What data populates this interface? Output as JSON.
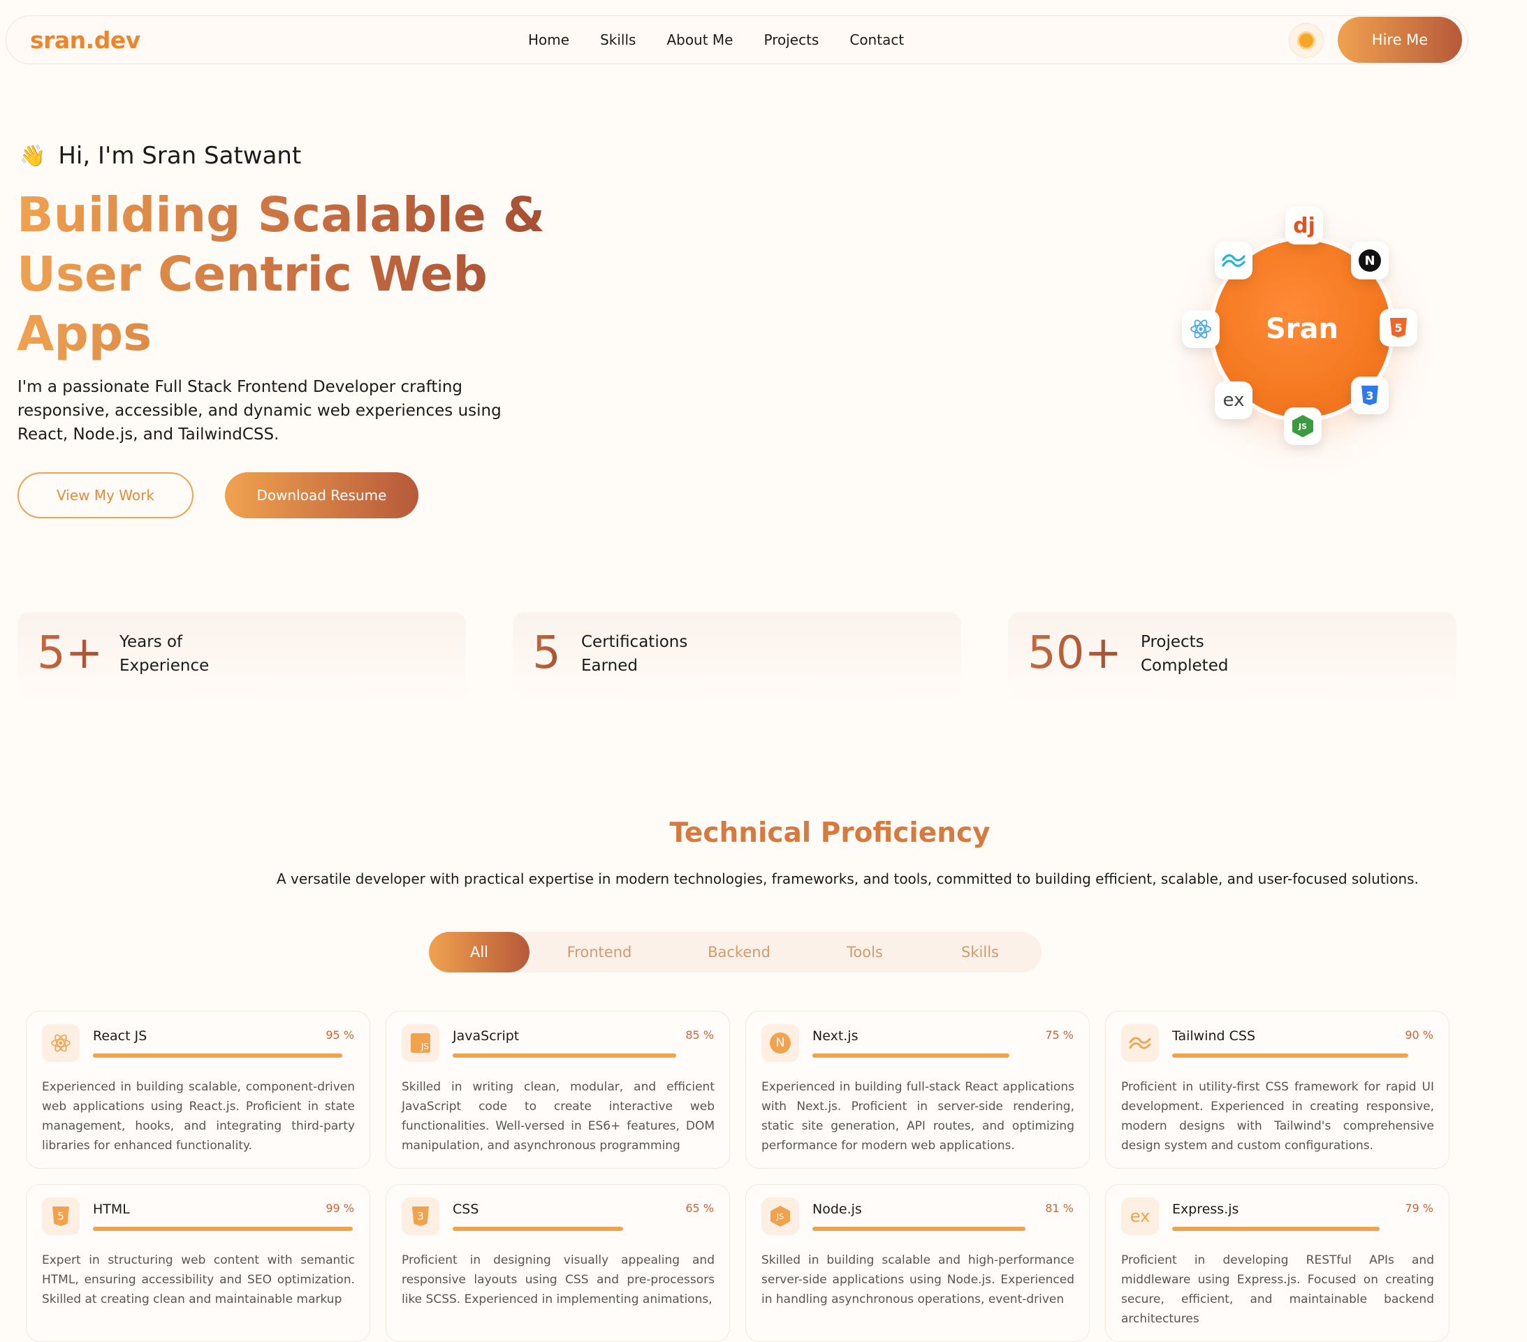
{
  "nav": {
    "logo": "sran.dev",
    "links": [
      "Home",
      "Skills",
      "About Me",
      "Projects",
      "Contact"
    ],
    "hire": "Hire Me",
    "theme_icon": "sun-icon"
  },
  "hero": {
    "greeting": "Hi, I'm Sran Satwant",
    "wave_icon": "👋",
    "headline": "Building Scalable & User Centric Web Apps",
    "description": "I'm a passionate Full Stack Frontend Developer crafting responsive, accessible, and dynamic web experiences using React, Node.js, and TailwindCSS.",
    "btn_work": "View My Work",
    "btn_resume": "Download Resume",
    "orb_label": "Sran",
    "orbit_icons": [
      "django-icon",
      "nextjs-icon",
      "html5-icon",
      "css3-icon",
      "nodejs-icon",
      "express-icon",
      "react-icon",
      "tailwind-icon"
    ],
    "orbit_texts": {
      "django": "dj",
      "nextjs": "N",
      "html5": "5",
      "css3": "3",
      "nodejs": "JS",
      "express": "ex"
    }
  },
  "stats": [
    {
      "number": "5+",
      "label": "Years of Experience"
    },
    {
      "number": "5",
      "label": "Certifications Earned"
    },
    {
      "number": "50+",
      "label": "Projects Completed"
    }
  ],
  "skills_section": {
    "title": "Technical Proficiency",
    "description": "A versatile developer with practical expertise in modern technologies, frameworks, and tools, committed to building efficient, scalable, and user-focused solutions.",
    "tabs": [
      "All",
      "Frontend",
      "Backend",
      "Tools",
      "Skills"
    ],
    "active_tab": "All",
    "cards": [
      {
        "name": "React JS",
        "percent": "95 %",
        "level": 95,
        "icon": "react-icon",
        "description": "Experienced in building scalable, component-driven web applications using React.js. Proficient in state management, hooks, and integrating third-party libraries for enhanced functionality."
      },
      {
        "name": "JavaScript",
        "percent": "85 %",
        "level": 85,
        "icon": "javascript-icon",
        "icon_text": "JS",
        "description": "Skilled in writing clean, modular, and efficient JavaScript code to create interactive web functionalities. Well-versed in ES6+ features, DOM manipulation, and asynchronous programming"
      },
      {
        "name": "Next.js",
        "percent": "75 %",
        "level": 75,
        "icon": "nextjs-icon",
        "icon_text": "N",
        "description": "Experienced in building full-stack React applications with Next.js. Proficient in server-side rendering, static site generation, API routes, and optimizing performance for modern web applications."
      },
      {
        "name": "Tailwind CSS",
        "percent": "90 %",
        "level": 90,
        "icon": "tailwind-icon",
        "description": "Proficient in utility-first CSS framework for rapid UI development. Experienced in creating responsive, modern designs with Tailwind's comprehensive design system and custom configurations."
      },
      {
        "name": "HTML",
        "percent": "99 %",
        "level": 99,
        "icon": "html5-icon",
        "icon_text": "5",
        "description": "Expert in structuring web content with semantic HTML, ensuring accessibility and SEO optimization. Skilled at creating clean and maintainable markup"
      },
      {
        "name": "CSS",
        "percent": "65 %",
        "level": 65,
        "icon": "css3-icon",
        "icon_text": "3",
        "description": "Proficient in designing visually appealing and responsive layouts using CSS and pre-processors like SCSS. Experienced in implementing animations,"
      },
      {
        "name": "Node.js",
        "percent": "81 %",
        "level": 81,
        "icon": "nodejs-icon",
        "icon_text": "JS",
        "description": "Skilled in building scalable and high-performance server-side applications using Node.js. Experienced in handling asynchronous operations, event-driven"
      },
      {
        "name": "Express.js",
        "percent": "79 %",
        "level": 79,
        "icon": "express-icon",
        "icon_text": "ex",
        "description": "Proficient in developing RESTful APIs and middleware using Express.js. Focused on creating secure, efficient, and maintainable backend architectures"
      }
    ]
  },
  "colors": {
    "accent": "#f0a24f",
    "accent_dark": "#b7593a",
    "logo": "#f0842c",
    "background": "#fffbf7"
  }
}
